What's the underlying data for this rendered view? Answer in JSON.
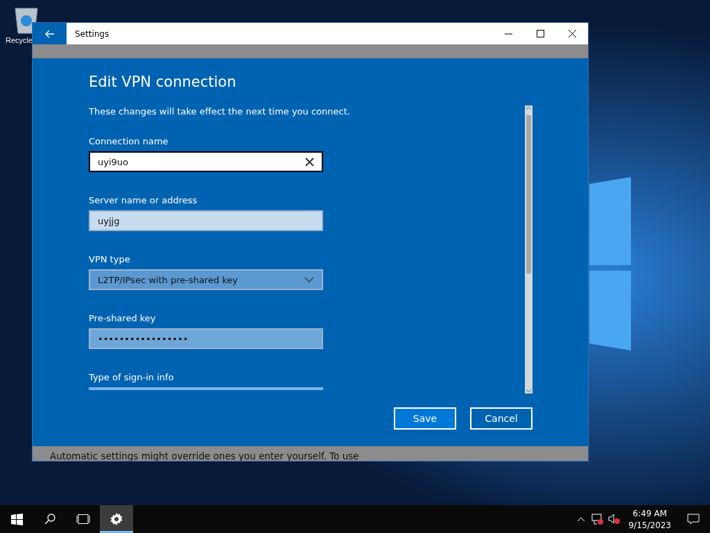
{
  "desktop": {
    "icons": [
      {
        "label": "Recycle"
      }
    ]
  },
  "window": {
    "title": "Settings",
    "heading": "Edit VPN connection",
    "note": "These changes will take effect the next time you connect.",
    "fields": [
      {
        "kind": "text",
        "label": "Connection name",
        "value": "uyi9uo",
        "focused": true
      },
      {
        "kind": "text",
        "label": "Server name or address",
        "value": "uyjjg",
        "focused": false
      },
      {
        "kind": "dropdown",
        "label": "VPN type",
        "value": "L2TP/IPsec with pre-shared key",
        "focused": false
      },
      {
        "kind": "password",
        "label": "Pre-shared key",
        "value": "•••••••••••••••••",
        "focused": false
      },
      {
        "kind": "dropdown",
        "label": "Type of sign-in info",
        "focused": false
      }
    ],
    "buttons": [
      {
        "label": "Save",
        "selected": true
      },
      {
        "label": "Cancel",
        "selected": false
      }
    ],
    "footer_text": "Automatic settings might override ones you enter yourself. To use"
  },
  "taskbar": {
    "apps": [
      {
        "kind": "settings",
        "selected": true
      }
    ],
    "time": "6:49 AM",
    "date": "9/15/2023"
  }
}
